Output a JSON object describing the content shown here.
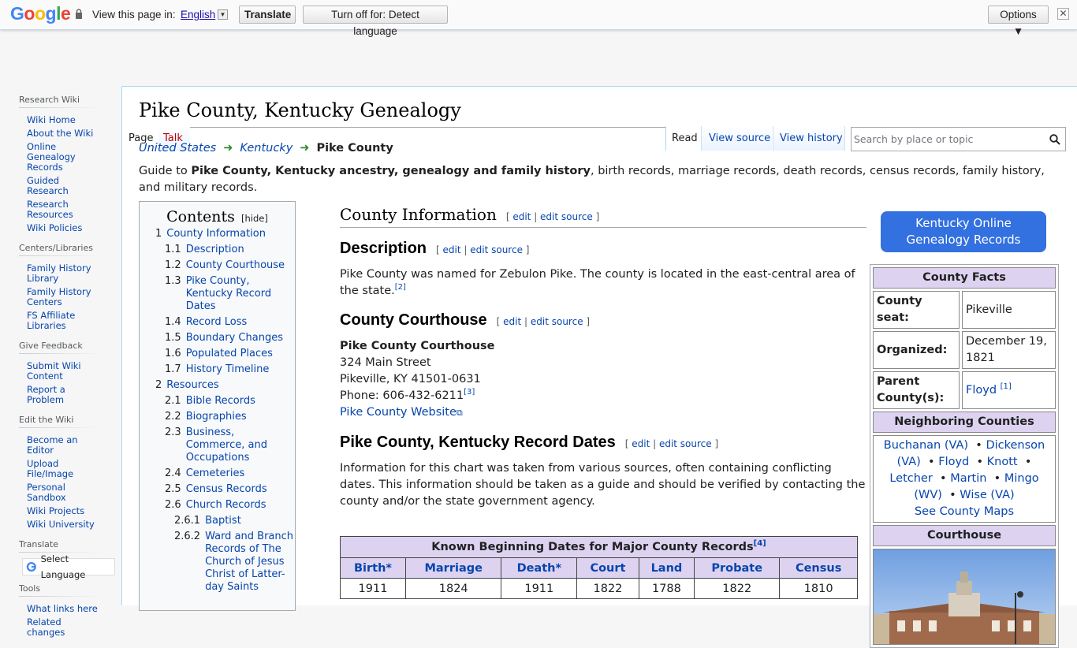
{
  "gbar": {
    "logo": [
      "G",
      "o",
      "o",
      "g",
      "l",
      "e"
    ],
    "view_text": "View this page in:",
    "language": "English",
    "translate": "Translate",
    "turn_off": "Turn off for: Detect language",
    "options": "Options ▼",
    "close": "✕"
  },
  "sidebar": {
    "sections": [
      {
        "title": "Research Wiki",
        "items": [
          "Wiki Home",
          "About the Wiki",
          "Online Genealogy Records",
          "Guided Research",
          "Research Resources",
          "Wiki Policies"
        ]
      },
      {
        "title": "Centers/Libraries",
        "items": [
          "Family History Library",
          "Family History Centers",
          "FS Affiliate Libraries"
        ]
      },
      {
        "title": "Give Feedback",
        "items": [
          "Submit Wiki Content",
          "Report a Problem"
        ]
      },
      {
        "title": "Edit the Wiki",
        "items": [
          "Become an Editor",
          "Upload File/Image",
          "Personal Sandbox",
          "Wiki Projects",
          "Wiki University"
        ]
      },
      {
        "title": "Translate",
        "select_label": "Select Language"
      },
      {
        "title": "Tools",
        "items": [
          "What links here",
          "Related changes"
        ]
      }
    ]
  },
  "tabs": {
    "page": "Page",
    "talk": "Talk",
    "read": "Read",
    "view_source": "View source",
    "view_history": "View history",
    "search_placeholder": "Search by place or topic"
  },
  "page": {
    "title": "Pike County, Kentucky Genealogy",
    "breadcrumb": [
      "United States",
      "Kentucky",
      "Pike County"
    ],
    "lead_prefix": "Guide to ",
    "lead_bold": "Pike County, Kentucky ancestry, genealogy and family history",
    "lead_suffix": ", birth records, marriage records, death records, census records, family history, and military records."
  },
  "toc": {
    "title": "Contents",
    "hide": "[hide]",
    "items": [
      {
        "num": "1",
        "label": "County Information",
        "level": 1
      },
      {
        "num": "1.1",
        "label": "Description",
        "level": 2
      },
      {
        "num": "1.2",
        "label": "County Courthouse",
        "level": 2
      },
      {
        "num": "1.3",
        "label": "Pike County, Kentucky Record Dates",
        "level": 2
      },
      {
        "num": "1.4",
        "label": "Record Loss",
        "level": 2
      },
      {
        "num": "1.5",
        "label": "Boundary Changes",
        "level": 2
      },
      {
        "num": "1.6",
        "label": "Populated Places",
        "level": 2
      },
      {
        "num": "1.7",
        "label": "History Timeline",
        "level": 2
      },
      {
        "num": "2",
        "label": "Resources",
        "level": 1
      },
      {
        "num": "2.1",
        "label": "Bible Records",
        "level": 2
      },
      {
        "num": "2.2",
        "label": "Biographies",
        "level": 2
      },
      {
        "num": "2.3",
        "label": "Business, Commerce, and Occupations",
        "level": 2
      },
      {
        "num": "2.4",
        "label": "Cemeteries",
        "level": 2
      },
      {
        "num": "2.5",
        "label": "Census Records",
        "level": 2
      },
      {
        "num": "2.6",
        "label": "Church Records",
        "level": 2
      },
      {
        "num": "2.6.1",
        "label": "Baptist",
        "level": 3
      },
      {
        "num": "2.6.2",
        "label": "Ward and Branch Records of The Church of Jesus Christ of Latter-day Saints",
        "level": 3
      }
    ]
  },
  "edit_links": {
    "edit": "edit",
    "edit_source": "edit source"
  },
  "sections": {
    "county_info": "County Information",
    "description": {
      "heading": "Description",
      "text": "Pike County was named for Zebulon Pike. The county is located in the east-central area of the state.",
      "ref": "[2]"
    },
    "courthouse": {
      "heading": "County Courthouse",
      "name": "Pike County Courthouse",
      "street": "324 Main Street",
      "city": "Pikeville, KY 41501-0631",
      "phone": "Phone: 606-432-6211",
      "ref": "[3]",
      "website": "Pike County Website"
    },
    "record_dates": {
      "heading": "Pike County, Kentucky Record Dates",
      "text": "Information for this chart was taken from various sources, often containing conflicting dates. This information should be taken as a guide and should be verified by contacting the county and/or the state government agency."
    }
  },
  "record_table": {
    "caption": "Known Beginning Dates for Major County Records",
    "ref": "[4]",
    "headers": [
      "Birth*",
      "Marriage",
      "Death*",
      "Court",
      "Land",
      "Probate",
      "Census"
    ],
    "values": [
      "1911",
      "1824",
      "1911",
      "1822",
      "1788",
      "1822",
      "1810"
    ]
  },
  "right": {
    "button_line1": "Kentucky Online",
    "button_line2": "Genealogy Records",
    "facts_title": "County Facts",
    "seat_label": "County seat:",
    "seat_value": "Pikeville",
    "organized_label": "Organized:",
    "organized_value": "December 19, 1821",
    "parent_label": "Parent County(s):",
    "parent_value": "Floyd",
    "parent_ref": "[1]",
    "neighbors_title": "Neighboring Counties",
    "neighbors": [
      "Buchanan (VA)",
      "Dickenson (VA)",
      "Floyd",
      "Knott",
      "Letcher",
      "Martin",
      "Mingo (WV)",
      "Wise (VA)"
    ],
    "see_maps": "See County Maps",
    "courthouse_title": "Courthouse"
  },
  "colors": {
    "link": "#0645ad",
    "accent_button": "#3370e0",
    "table_header": "#ddd3f0"
  }
}
